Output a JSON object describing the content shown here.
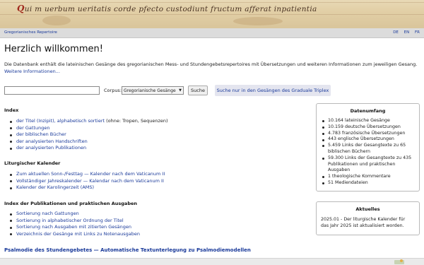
{
  "banner": {
    "initial": "Q",
    "script_text": "ui m uerbum ueritatis corde pfecto custodiunt fructum afferat inpatientia"
  },
  "nav": {
    "home": "Gregorianisches Repertoire",
    "langs": [
      "DE",
      "EN",
      "FR"
    ]
  },
  "page_title": "Herzlich willkommen!",
  "intro": {
    "text": "Die Datenbank enthält die lateinischen Gesänge des gregorianischen Mess- und Stundengebetsrepertoires mit Übersetzungen und weiteren Informationen zum jeweiligen Gesang.",
    "more_link": "Weitere Informationen..."
  },
  "search": {
    "input_value": "",
    "corpus_label": "Corpus:",
    "corpus_selected": "Gregorianische Gesänge",
    "search_button": "Suche",
    "gt_button": "Suche nur in den Gesängen des Graduale Triplex"
  },
  "index": {
    "heading": "Index",
    "items": [
      {
        "link": "der Titel (Inzipit), alphabetisch sortiert",
        "suffix": " (ohne: Tropen, Sequenzen)"
      },
      {
        "link": "der Gattungen",
        "suffix": ""
      },
      {
        "link": "der biblischen Bücher",
        "suffix": ""
      },
      {
        "link": "der analysierten Handschriften",
        "suffix": ""
      },
      {
        "link": "der analysierten Publikationen",
        "suffix": ""
      }
    ]
  },
  "calendar": {
    "heading": "Liturgischer Kalender",
    "items": [
      "Zum aktuellen Sonn-/Festtag — Kalender nach dem Vaticanum II",
      "Vollständiger Jahreskalender — Kalendar nach dem Vaticanum II",
      "Kalender der Karolingerzeit (AMS)"
    ]
  },
  "publications": {
    "heading": "Index der Publikationen und praktischen Ausgaben",
    "items": [
      "Sortierung nach Gattungen",
      "Sortierung in alphabetischer Ordnung der Titel",
      "Sortierung nach Ausgaben mit zitierten Gesängen",
      "Verzeichnis der Gesänge mit Links zu Notenausgaben"
    ]
  },
  "psalmody_link": "Psalmodie des Stundengebetes — Automatische Textunterlegung zu Psalmodiemodellen",
  "stats": {
    "title": "Datenumfang",
    "items": [
      "10.164 lateinische Gesänge",
      "10.159 deutsche Übersetzungen",
      "4.783 französische Übersetzungen",
      "443 englische Übersetzungen",
      "5.459 Links der Gesangtexte zu 65 biblischen Büchern",
      "59.300 Links der Gesangtexte zu 435 Publikationen und praktischen Ausgaben",
      "1 theologische Kommentare",
      "51 Mediendateien"
    ]
  },
  "news": {
    "title": "Aktuelles",
    "text": "2025.01 - Der liturgische Kalender für das Jahr 2025 ist aktualisiert worden."
  },
  "colors": {
    "link": "#1a3a9a",
    "navbar": "#dcdcdc",
    "gt_button": "#e4e5ef"
  }
}
